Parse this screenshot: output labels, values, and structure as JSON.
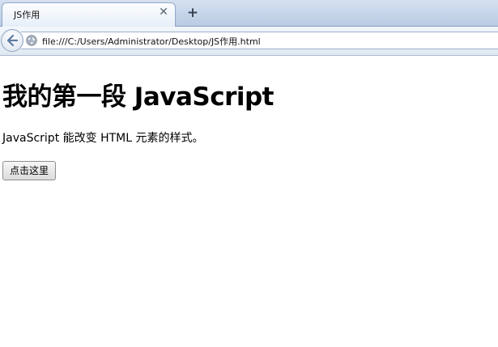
{
  "browser": {
    "tab_title": "JS作用",
    "close_glyph": "✕",
    "new_tab_glyph": "+",
    "address": "file:///C:/Users/Administrator/Desktop/JS作用.html"
  },
  "page": {
    "heading": "我的第一段 JavaScript",
    "paragraph": "JavaScript 能改变 HTML 元素的样式。",
    "button_label": "点击这里"
  },
  "colors": {
    "tab_strip": "#c6d6ea",
    "content_bg": "#ffffff"
  }
}
